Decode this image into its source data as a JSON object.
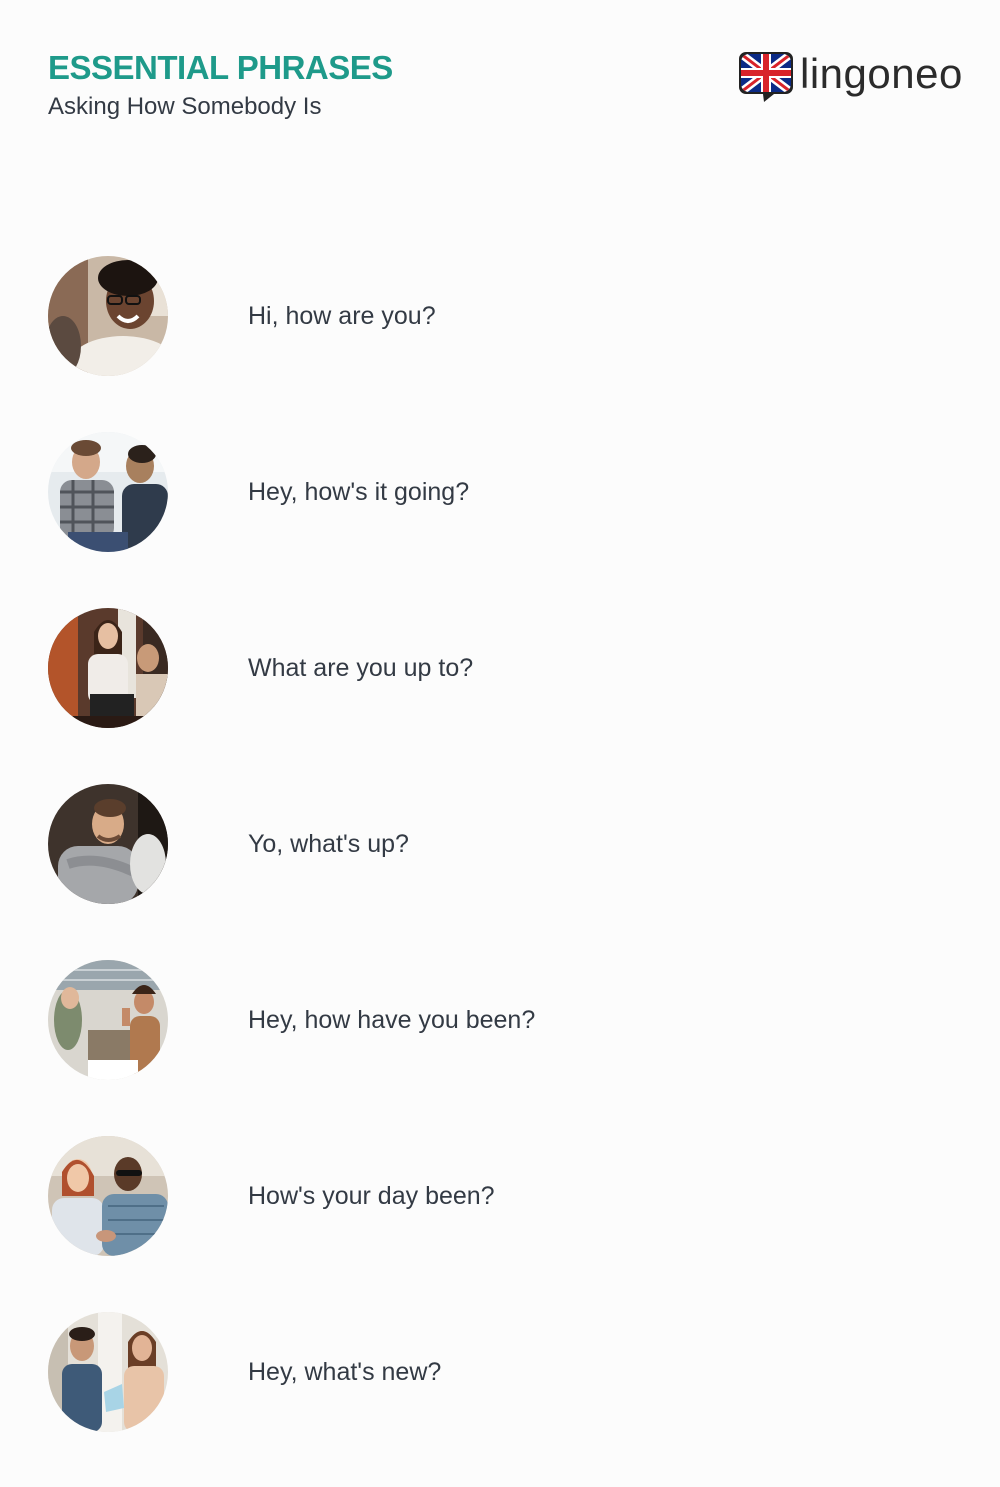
{
  "header": {
    "title": "ESSENTIAL PHRASES",
    "subtitle": "Asking How Somebody Is"
  },
  "logo": {
    "text": "lingoneo",
    "icon": "uk-flag-speech-bubble-icon"
  },
  "colors": {
    "title": "#1e9a8a",
    "text": "#333a44",
    "background": "#fcfcfc"
  },
  "phrases": [
    {
      "text": "Hi, how are you?",
      "image": "smiling-woman-with-glasses-photo"
    },
    {
      "text": "Hey, how's it going?",
      "image": "two-men-talking-photo"
    },
    {
      "text": "What are you up to?",
      "image": "women-at-cafe-with-laptop-photo"
    },
    {
      "text": "Yo, what's up?",
      "image": "men-hugging-photo"
    },
    {
      "text": "Hey, how have you been?",
      "image": "coworkers-waving-photo"
    },
    {
      "text": "How's your day been?",
      "image": "office-handshake-photo"
    },
    {
      "text": "Hey, what's new?",
      "image": "colleagues-in-office-photo"
    }
  ]
}
